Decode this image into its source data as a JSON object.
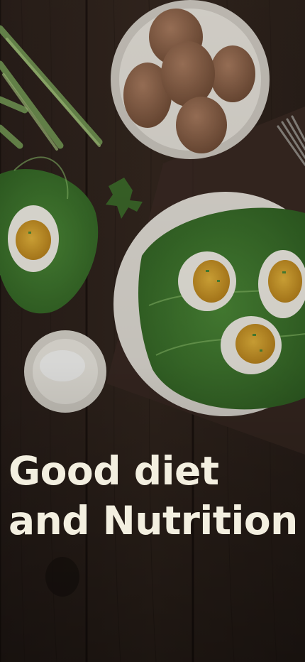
{
  "hero": {
    "image_description": "overhead photo of deviled eggs on lettuce, brown eggs in a bowl, green onions, sour cream dip, fork on dark wooden table",
    "title_line1": "Good diet",
    "title_line2": "and Nutrition"
  },
  "colors": {
    "title": "#f3efe0",
    "wood_dark": "#2a1f1a",
    "wood_light": "#3b2c24"
  }
}
